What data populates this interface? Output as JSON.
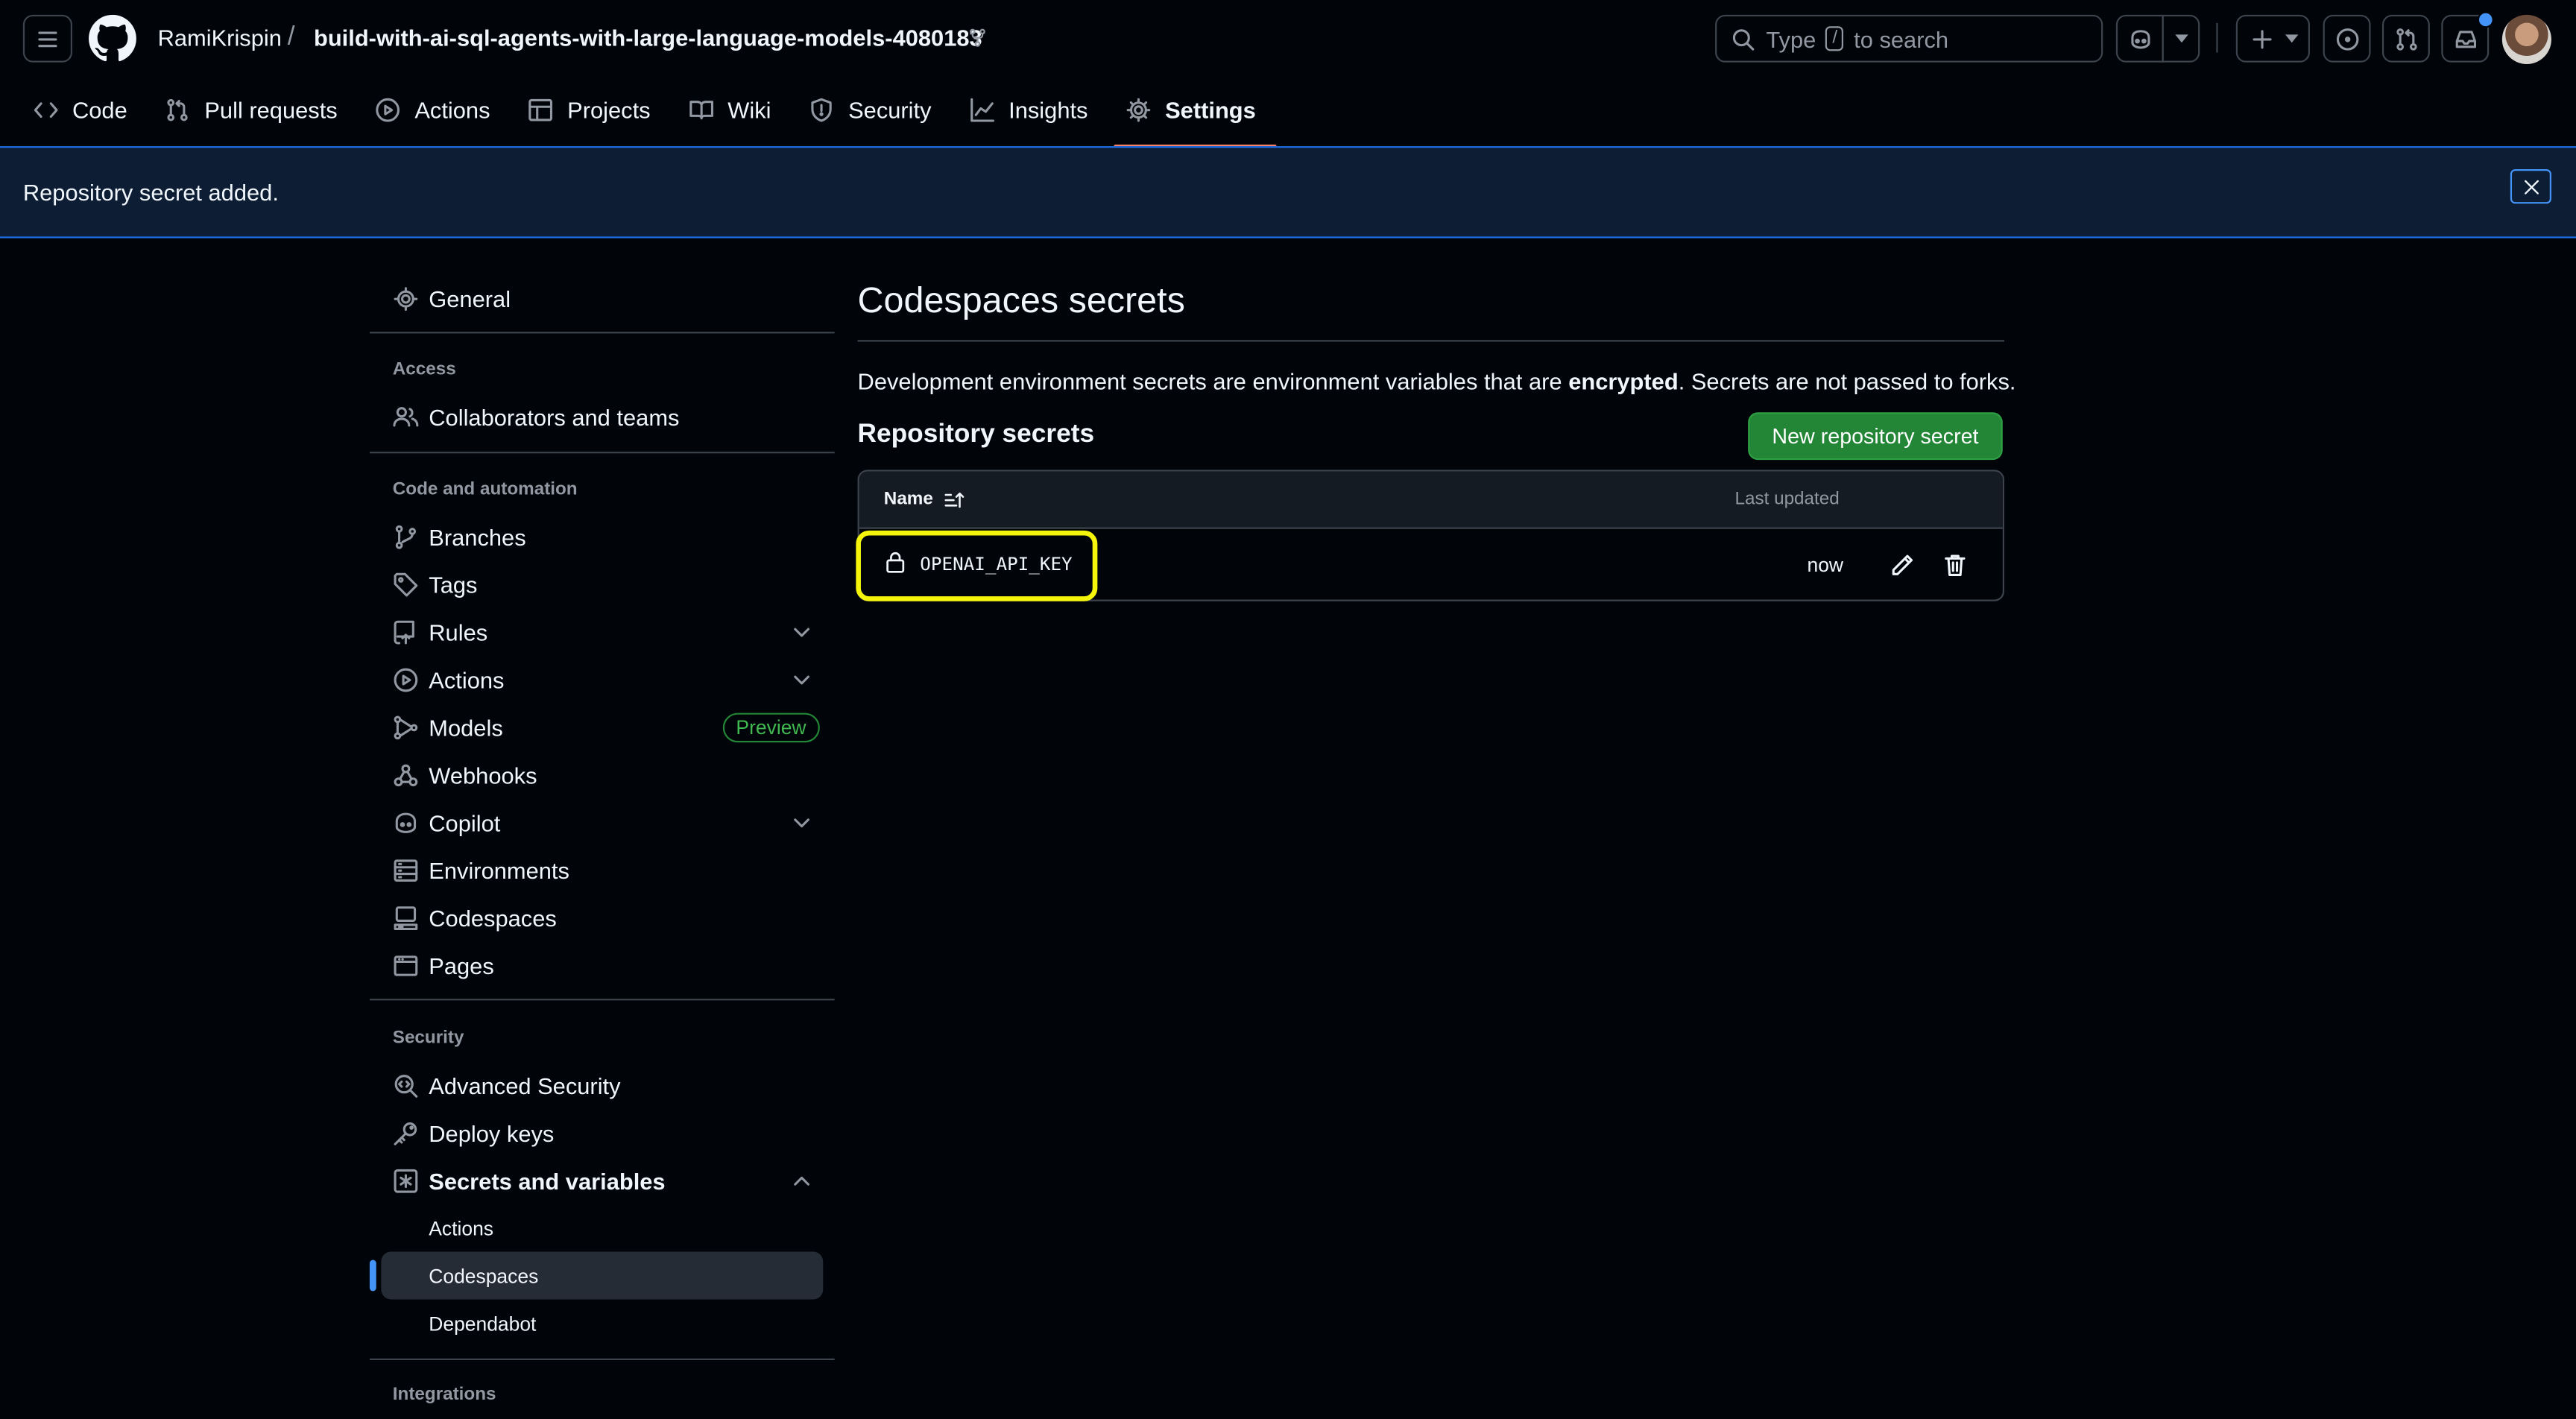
{
  "header": {
    "owner": "RamiKrispin",
    "separator": "/",
    "repo": "build-with-ai-sql-agents-with-large-language-models-4080183",
    "search_pre": "Type",
    "search_key": "/",
    "search_post": "to search"
  },
  "tabs": [
    {
      "label": "Code",
      "icon": "code-icon"
    },
    {
      "label": "Pull requests",
      "icon": "git-pull-request-icon"
    },
    {
      "label": "Actions",
      "icon": "play-icon"
    },
    {
      "label": "Projects",
      "icon": "table-icon"
    },
    {
      "label": "Wiki",
      "icon": "book-icon"
    },
    {
      "label": "Security",
      "icon": "shield-icon"
    },
    {
      "label": "Insights",
      "icon": "graph-icon"
    },
    {
      "label": "Settings",
      "icon": "gear-icon",
      "active": true
    }
  ],
  "flash": {
    "message": "Repository secret added."
  },
  "sidebar": {
    "general": "General",
    "group_access": "Access",
    "collaborators": "Collaborators and teams",
    "group_code": "Code and automation",
    "branches": "Branches",
    "tags": "Tags",
    "rules": "Rules",
    "actions": "Actions",
    "models": "Models",
    "models_badge": "Preview",
    "webhooks": "Webhooks",
    "copilot": "Copilot",
    "environments": "Environments",
    "codespaces": "Codespaces",
    "pages": "Pages",
    "group_security": "Security",
    "advanced_security": "Advanced Security",
    "deploy_keys": "Deploy keys",
    "secrets_and_variables": "Secrets and variables",
    "sub_actions": "Actions",
    "sub_codespaces": "Codespaces",
    "sub_dependabot": "Dependabot",
    "group_integrations": "Integrations"
  },
  "main": {
    "title": "Codespaces secrets",
    "desc_pre": "Development environment secrets are environment variables that are ",
    "desc_bold": "encrypted",
    "desc_post": ". Secrets are not passed to forks.",
    "section_title": "Repository secrets",
    "new_button": "New repository secret",
    "table": {
      "col_name": "Name",
      "col_updated": "Last updated",
      "rows": [
        {
          "name": "OPENAI_API_KEY",
          "updated": "now"
        }
      ]
    }
  },
  "colors": {
    "background": "#010409",
    "accent_tab_underline": "#f78166",
    "primary_button": "#238636",
    "highlight": "#f5f50c",
    "flash_border": "#1f6feb"
  }
}
